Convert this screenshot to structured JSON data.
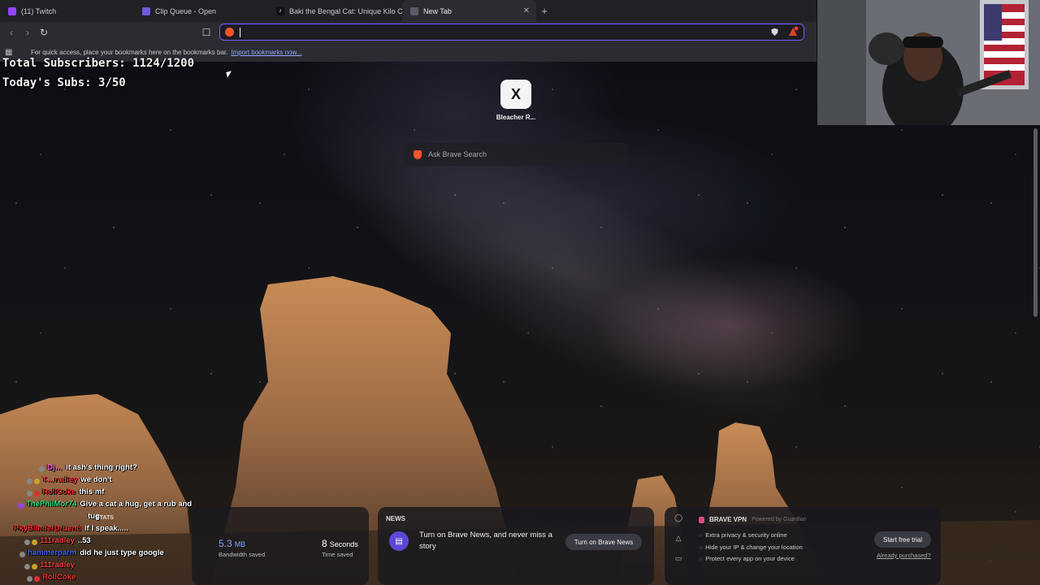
{
  "browser": {
    "tabs": [
      {
        "label": "(11) Twitch",
        "icon_color": "#9146ff",
        "active": false
      },
      {
        "label": "Clip Queue - Open",
        "icon_color": "#6f5bd9",
        "active": false
      },
      {
        "label": "Baki the Bengal Cat: Unique Kilo Cha",
        "icon_color": "#111111",
        "active": false
      },
      {
        "label": "New Tab",
        "icon_color": "#5a5a66",
        "active": true
      }
    ],
    "new_tab_glyph": "+",
    "close_glyph": "✕",
    "address_value": "",
    "bookmarks_bar": {
      "message": "For quick access, place your bookmarks here on the bookmarks bar.",
      "import_link": "Import bookmarks now..."
    }
  },
  "overlay": {
    "total_subscribers": "Total Subscribers: 1124/1200",
    "todays_subs": "Today's Subs: 3/50"
  },
  "new_tab_page": {
    "top_site": {
      "label": "Bleacher R...",
      "glyph": "X"
    },
    "search_placeholder": "Ask Brave Search"
  },
  "chat": [
    {
      "user": "Dj…",
      "user_color": "#ff5fd7",
      "text": "it ash's thing right?"
    },
    {
      "user": "T…radley",
      "user_color": "#ff4040",
      "text": "we don't"
    },
    {
      "user": "RollCoke",
      "user_color": "#ff2a2a",
      "text": "this mf"
    },
    {
      "user": "ThePhilMor74",
      "user_color": "#35e07a",
      "text": "Give a cat a hug, get a rub and"
    },
    {
      "user": "",
      "user_color": "#ffffff",
      "text": "tug"
    },
    {
      "user": "PkyBlinderDrLend",
      "user_color": "#ff2a2a",
      "text": "if I speak....."
    },
    {
      "user": "111radley",
      "user_color": "#ff4040",
      "text": "..53"
    },
    {
      "user": "hammerparm",
      "user_color": "#4060ff",
      "text": "did he just type google"
    },
    {
      "user": "111radley",
      "user_color": "#ff4040",
      "text": ""
    },
    {
      "user": "RollCoke",
      "user_color": "#ff2a2a",
      "text": ""
    }
  ],
  "stats": {
    "title": "STATS",
    "bandwidth_value": "5.3",
    "bandwidth_unit": "MB",
    "bandwidth_label": "Bandwidth saved",
    "time_value": "8",
    "time_unit": "Seconds",
    "time_label": "Time saved"
  },
  "news": {
    "title": "NEWS",
    "body": "Turn on Brave News, and never miss a story",
    "button": "Turn on Brave News"
  },
  "vpn": {
    "title": "BRAVE VPN",
    "powered_by": "Powered by Guardian",
    "features": [
      "Extra privacy & security online",
      "Hide your IP & change your location",
      "Protect every app on your device"
    ],
    "trial_button": "Start free trial",
    "purchased_link": "Already purchased?"
  },
  "colors": {
    "accent": "#7a5af8",
    "brave_orange": "#fb542b",
    "link_blue": "#8fa7ff"
  }
}
